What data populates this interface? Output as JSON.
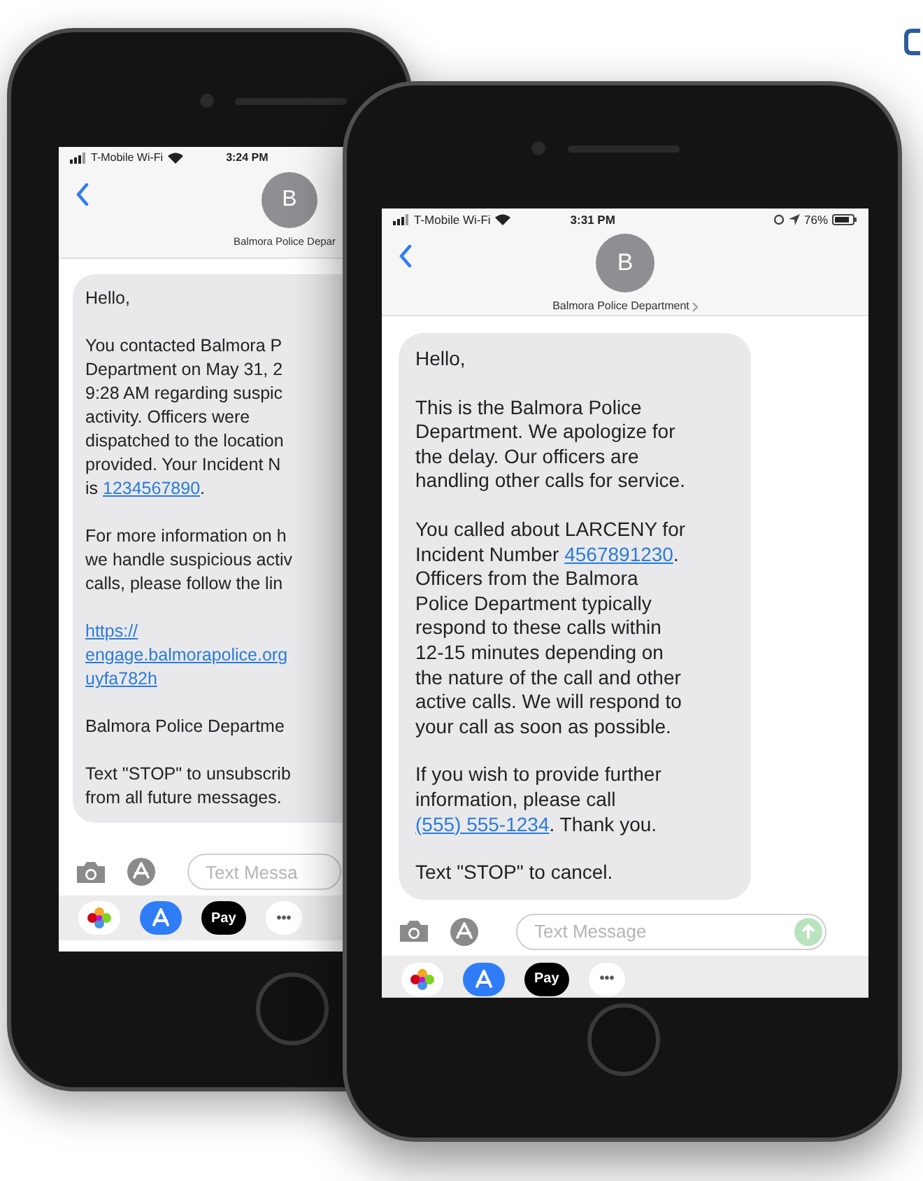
{
  "phones": [
    {
      "status": {
        "carrier": "T-Mobile Wi-Fi",
        "time": "3:24 PM"
      },
      "contact": {
        "avatar": "B",
        "name": "Balmora Police Depar"
      },
      "message": [
        [
          {
            "kind": "text",
            "text": "Hello,"
          }
        ],
        [
          {
            "kind": "text",
            "text": "You contacted Balmora P\nDepartment on May 31, 2\n9:28 AM regarding suspic\nactivity. Officers were\ndispatched to the location\nprovided. Your Incident N\nis "
          },
          {
            "kind": "link",
            "text": "1234567890"
          },
          {
            "kind": "text",
            "text": "."
          }
        ],
        [
          {
            "kind": "text",
            "text": "For more information on h\nwe handle suspicious activ\ncalls, please follow the lin"
          }
        ],
        [
          {
            "kind": "link",
            "text": "https://\nengage.balmorapolice.org\nuyfa782h"
          }
        ],
        [
          {
            "kind": "text",
            "text": "Balmora Police Departme"
          }
        ],
        [
          {
            "kind": "text",
            "text": "Text \"STOP\" to unsubscrib\nfrom all future messages."
          }
        ]
      ],
      "input": {
        "placeholder": "Text Messa"
      },
      "dock": {
        "pay": "Pay",
        "more": "•••"
      }
    },
    {
      "status": {
        "carrier": "T-Mobile Wi-Fi",
        "time": "3:31 PM",
        "battery": "76%"
      },
      "contact": {
        "avatar": "B",
        "name": "Balmora Police Department"
      },
      "message": [
        [
          {
            "kind": "text",
            "text": "Hello,"
          }
        ],
        [
          {
            "kind": "text",
            "text": "This is the Balmora Police\nDepartment. We apologize for\nthe delay. Our officers are\nhandling other calls for service."
          }
        ],
        [
          {
            "kind": "text",
            "text": "You called about LARCENY for\nIncident Number "
          },
          {
            "kind": "link",
            "text": "4567891230"
          },
          {
            "kind": "text",
            "text": ".\nOfficers from the Balmora\nPolice Department typically\nrespond to these calls within\n12-15 minutes depending on\nthe nature of the call and other\nactive calls. We will respond to\nyour call as soon as possible."
          }
        ],
        [
          {
            "kind": "text",
            "text": "If you wish to provide further\ninformation, please call\n"
          },
          {
            "kind": "link",
            "text": "(555) 555-1234"
          },
          {
            "kind": "text",
            "text": ". Thank you."
          }
        ],
        [
          {
            "kind": "text",
            "text": "Text \"STOP\" to cancel."
          }
        ]
      ],
      "input": {
        "placeholder": "Text Message"
      },
      "dock": {
        "pay": "Pay",
        "more": "•••"
      }
    }
  ]
}
